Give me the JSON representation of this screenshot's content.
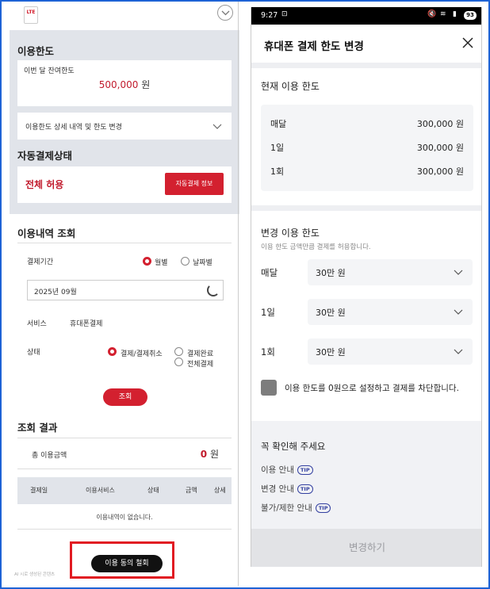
{
  "left": {
    "lte_badge": "LTE",
    "usage_limit_title": "이용한도",
    "remain_label": "이번 달 잔여한도",
    "remain_amount": "500,000",
    "remain_unit": "원",
    "detail_link": "이용한도 상세 내역 및 한도 변경",
    "auto_pay_title": "자동결제상태",
    "auto_pay_status": "전체 허용",
    "auto_pay_info_button": "자동결제 정보",
    "inquiry_title": "이용내역 조회",
    "period_label": "결제기간",
    "radio_monthly": "월별",
    "radio_daily": "날짜별",
    "selected_month": "2025년 09월",
    "service_label": "서비스",
    "service_value": "휴대폰결제",
    "state_label": "상태",
    "state_opt1": "결제/결제취소",
    "state_opt2": "결제완료",
    "state_opt3": "전체결제",
    "query_button": "조회",
    "result_title": "조회 결과",
    "total_label": "총 이용금액",
    "total_amount": "0",
    "total_unit": "원",
    "table_headers": [
      "결제일",
      "이용서비스",
      "상태",
      "금액",
      "상세"
    ],
    "table_empty": "이용내역이 없습니다.",
    "withdraw_button": "이용 동의 철회",
    "footer_tiny": "AI 시로 생성된 콘텐츠"
  },
  "right": {
    "status": {
      "time": "9:27",
      "battery": "93"
    },
    "title": "휴대폰 결제 한도 변경",
    "current_title": "현재 이용 한도",
    "current_rows": [
      {
        "k": "매달",
        "v": "300,000 원"
      },
      {
        "k": "1일",
        "v": "300,000 원"
      },
      {
        "k": "1회",
        "v": "300,000 원"
      }
    ],
    "change_title": "변경 이용 한도",
    "change_hint": "이용 한도 금액만큼 결제를 허용합니다.",
    "change_rows": [
      {
        "k": "매달",
        "v": "30만 원"
      },
      {
        "k": "1일",
        "v": "30만 원"
      },
      {
        "k": "1회",
        "v": "30만 원"
      }
    ],
    "block_checkbox_label": "이용 한도를 0원으로 설정하고 결제를 차단합니다.",
    "check_title": "꼭 확인해 주세요",
    "tip_rows": [
      "이용 안내",
      "변경 안내",
      "불가/제한 안내"
    ],
    "tip_badge": "TIP",
    "submit_button": "변경하기"
  }
}
